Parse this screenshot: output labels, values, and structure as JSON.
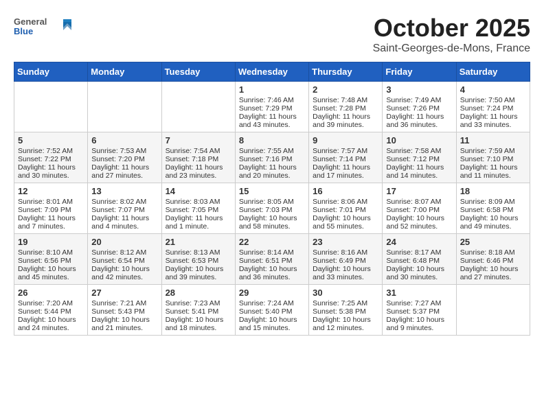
{
  "header": {
    "logo": {
      "general": "General",
      "blue": "Blue"
    },
    "month": "October 2025",
    "location": "Saint-Georges-de-Mons, France"
  },
  "weekdays": [
    "Sunday",
    "Monday",
    "Tuesday",
    "Wednesday",
    "Thursday",
    "Friday",
    "Saturday"
  ],
  "weeks": [
    [
      {
        "day": "",
        "sunrise": "",
        "sunset": "",
        "daylight": ""
      },
      {
        "day": "",
        "sunrise": "",
        "sunset": "",
        "daylight": ""
      },
      {
        "day": "",
        "sunrise": "",
        "sunset": "",
        "daylight": ""
      },
      {
        "day": "1",
        "sunrise": "Sunrise: 7:46 AM",
        "sunset": "Sunset: 7:29 PM",
        "daylight": "Daylight: 11 hours and 43 minutes."
      },
      {
        "day": "2",
        "sunrise": "Sunrise: 7:48 AM",
        "sunset": "Sunset: 7:28 PM",
        "daylight": "Daylight: 11 hours and 39 minutes."
      },
      {
        "day": "3",
        "sunrise": "Sunrise: 7:49 AM",
        "sunset": "Sunset: 7:26 PM",
        "daylight": "Daylight: 11 hours and 36 minutes."
      },
      {
        "day": "4",
        "sunrise": "Sunrise: 7:50 AM",
        "sunset": "Sunset: 7:24 PM",
        "daylight": "Daylight: 11 hours and 33 minutes."
      }
    ],
    [
      {
        "day": "5",
        "sunrise": "Sunrise: 7:52 AM",
        "sunset": "Sunset: 7:22 PM",
        "daylight": "Daylight: 11 hours and 30 minutes."
      },
      {
        "day": "6",
        "sunrise": "Sunrise: 7:53 AM",
        "sunset": "Sunset: 7:20 PM",
        "daylight": "Daylight: 11 hours and 27 minutes."
      },
      {
        "day": "7",
        "sunrise": "Sunrise: 7:54 AM",
        "sunset": "Sunset: 7:18 PM",
        "daylight": "Daylight: 11 hours and 23 minutes."
      },
      {
        "day": "8",
        "sunrise": "Sunrise: 7:55 AM",
        "sunset": "Sunset: 7:16 PM",
        "daylight": "Daylight: 11 hours and 20 minutes."
      },
      {
        "day": "9",
        "sunrise": "Sunrise: 7:57 AM",
        "sunset": "Sunset: 7:14 PM",
        "daylight": "Daylight: 11 hours and 17 minutes."
      },
      {
        "day": "10",
        "sunrise": "Sunrise: 7:58 AM",
        "sunset": "Sunset: 7:12 PM",
        "daylight": "Daylight: 11 hours and 14 minutes."
      },
      {
        "day": "11",
        "sunrise": "Sunrise: 7:59 AM",
        "sunset": "Sunset: 7:10 PM",
        "daylight": "Daylight: 11 hours and 11 minutes."
      }
    ],
    [
      {
        "day": "12",
        "sunrise": "Sunrise: 8:01 AM",
        "sunset": "Sunset: 7:09 PM",
        "daylight": "Daylight: 11 hours and 7 minutes."
      },
      {
        "day": "13",
        "sunrise": "Sunrise: 8:02 AM",
        "sunset": "Sunset: 7:07 PM",
        "daylight": "Daylight: 11 hours and 4 minutes."
      },
      {
        "day": "14",
        "sunrise": "Sunrise: 8:03 AM",
        "sunset": "Sunset: 7:05 PM",
        "daylight": "Daylight: 11 hours and 1 minute."
      },
      {
        "day": "15",
        "sunrise": "Sunrise: 8:05 AM",
        "sunset": "Sunset: 7:03 PM",
        "daylight": "Daylight: 10 hours and 58 minutes."
      },
      {
        "day": "16",
        "sunrise": "Sunrise: 8:06 AM",
        "sunset": "Sunset: 7:01 PM",
        "daylight": "Daylight: 10 hours and 55 minutes."
      },
      {
        "day": "17",
        "sunrise": "Sunrise: 8:07 AM",
        "sunset": "Sunset: 7:00 PM",
        "daylight": "Daylight: 10 hours and 52 minutes."
      },
      {
        "day": "18",
        "sunrise": "Sunrise: 8:09 AM",
        "sunset": "Sunset: 6:58 PM",
        "daylight": "Daylight: 10 hours and 49 minutes."
      }
    ],
    [
      {
        "day": "19",
        "sunrise": "Sunrise: 8:10 AM",
        "sunset": "Sunset: 6:56 PM",
        "daylight": "Daylight: 10 hours and 45 minutes."
      },
      {
        "day": "20",
        "sunrise": "Sunrise: 8:12 AM",
        "sunset": "Sunset: 6:54 PM",
        "daylight": "Daylight: 10 hours and 42 minutes."
      },
      {
        "day": "21",
        "sunrise": "Sunrise: 8:13 AM",
        "sunset": "Sunset: 6:53 PM",
        "daylight": "Daylight: 10 hours and 39 minutes."
      },
      {
        "day": "22",
        "sunrise": "Sunrise: 8:14 AM",
        "sunset": "Sunset: 6:51 PM",
        "daylight": "Daylight: 10 hours and 36 minutes."
      },
      {
        "day": "23",
        "sunrise": "Sunrise: 8:16 AM",
        "sunset": "Sunset: 6:49 PM",
        "daylight": "Daylight: 10 hours and 33 minutes."
      },
      {
        "day": "24",
        "sunrise": "Sunrise: 8:17 AM",
        "sunset": "Sunset: 6:48 PM",
        "daylight": "Daylight: 10 hours and 30 minutes."
      },
      {
        "day": "25",
        "sunrise": "Sunrise: 8:18 AM",
        "sunset": "Sunset: 6:46 PM",
        "daylight": "Daylight: 10 hours and 27 minutes."
      }
    ],
    [
      {
        "day": "26",
        "sunrise": "Sunrise: 7:20 AM",
        "sunset": "Sunset: 5:44 PM",
        "daylight": "Daylight: 10 hours and 24 minutes."
      },
      {
        "day": "27",
        "sunrise": "Sunrise: 7:21 AM",
        "sunset": "Sunset: 5:43 PM",
        "daylight": "Daylight: 10 hours and 21 minutes."
      },
      {
        "day": "28",
        "sunrise": "Sunrise: 7:23 AM",
        "sunset": "Sunset: 5:41 PM",
        "daylight": "Daylight: 10 hours and 18 minutes."
      },
      {
        "day": "29",
        "sunrise": "Sunrise: 7:24 AM",
        "sunset": "Sunset: 5:40 PM",
        "daylight": "Daylight: 10 hours and 15 minutes."
      },
      {
        "day": "30",
        "sunrise": "Sunrise: 7:25 AM",
        "sunset": "Sunset: 5:38 PM",
        "daylight": "Daylight: 10 hours and 12 minutes."
      },
      {
        "day": "31",
        "sunrise": "Sunrise: 7:27 AM",
        "sunset": "Sunset: 5:37 PM",
        "daylight": "Daylight: 10 hours and 9 minutes."
      },
      {
        "day": "",
        "sunrise": "",
        "sunset": "",
        "daylight": ""
      }
    ]
  ]
}
